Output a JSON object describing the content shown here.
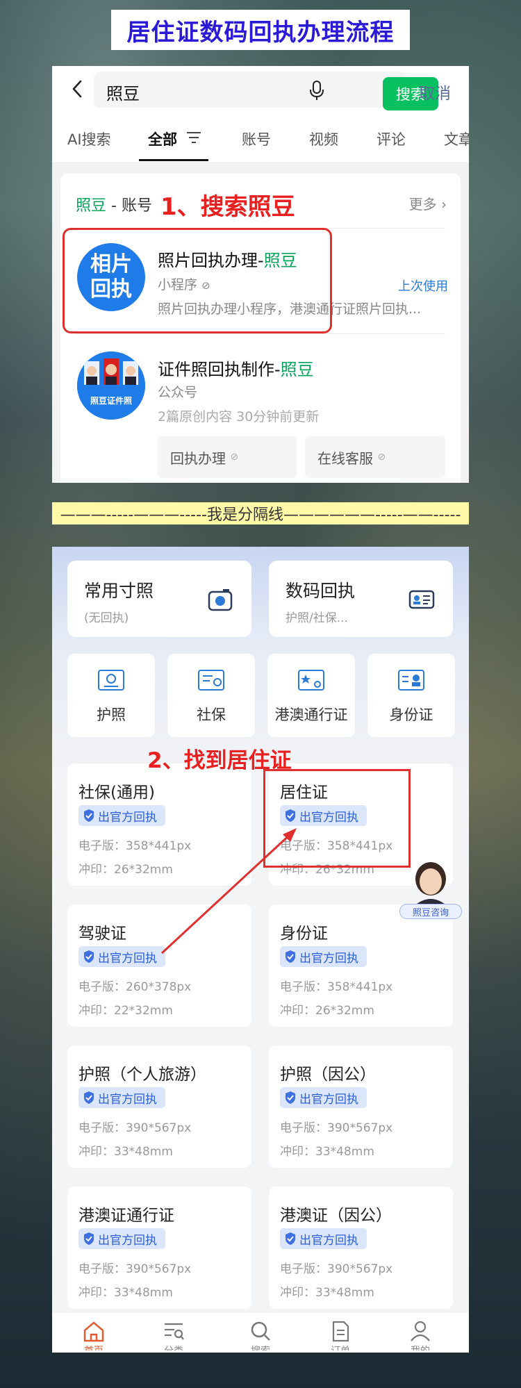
{
  "banner": {
    "title": "居住证数码回执办理流程"
  },
  "search": {
    "query": "照豆",
    "button": "搜索",
    "cancel": "取消",
    "tabs": [
      "AI搜索",
      "全部",
      "账号",
      "视频",
      "评论",
      "文章"
    ],
    "active_tab": "全部",
    "section_keyword": "照豆",
    "section_suffix": " - 账号",
    "more": "更多",
    "annotation": "1、搜索照豆",
    "results": [
      {
        "avatar_text": "相片回执",
        "title_prefix": "照片回执办理-",
        "title_highlight": "照豆",
        "type": "小程序",
        "desc": "照片回执办理小程序，港澳通行证照片回执...",
        "badge": "上次使用"
      },
      {
        "avatar_text": "照豆证件照",
        "title_prefix": "证件照回执制作-",
        "title_highlight": "照豆",
        "type": "公众号",
        "meta": "2篇原创内容  30分钟前更新",
        "buttons": [
          "回执办理",
          "在线客服"
        ]
      }
    ]
  },
  "separator": {
    "text": "———-----———-----我是分隔线——————-----——-----"
  },
  "app": {
    "features": [
      {
        "title": "常用寸照",
        "sub": "(无回执)"
      },
      {
        "title": "数码回执",
        "sub": "护照/社保..."
      }
    ],
    "categories": [
      "护照",
      "社保",
      "港澳通行证",
      "身份证"
    ],
    "annotation": "2、找到居住证",
    "consult_label": "照豆咨询",
    "documents": [
      {
        "title": "社保(通用)",
        "badge": "出官方回执",
        "electronic": "电子版：358*441px",
        "print": "冲印：26*32mm"
      },
      {
        "title": "居住证",
        "badge": "出官方回执",
        "electronic": "电子版：358*441px",
        "print": "冲印：26*32mm"
      },
      {
        "title": "驾驶证",
        "badge": "出官方回执",
        "electronic": "电子版：260*378px",
        "print": "冲印：22*32mm"
      },
      {
        "title": "身份证",
        "badge": "出官方回执",
        "electronic": "电子版：358*441px",
        "print": "冲印：26*32mm"
      },
      {
        "title": "护照（个人旅游）",
        "badge": "出官方回执",
        "electronic": "电子版：390*567px",
        "print": "冲印：33*48mm"
      },
      {
        "title": "护照（因公）",
        "badge": "出官方回执",
        "electronic": "电子版：390*567px",
        "print": "冲印：33*48mm"
      },
      {
        "title": "港澳证通行证",
        "badge": "出官方回执",
        "electronic": "电子版：390*567px",
        "print": "冲印：33*48mm"
      },
      {
        "title": "港澳证（因公）",
        "badge": "出官方回执",
        "electronic": "电子版：390*567px",
        "print": "冲印：33*48mm"
      }
    ],
    "nav": [
      "首页",
      "分类",
      "搜索",
      "订单",
      "我的"
    ]
  }
}
